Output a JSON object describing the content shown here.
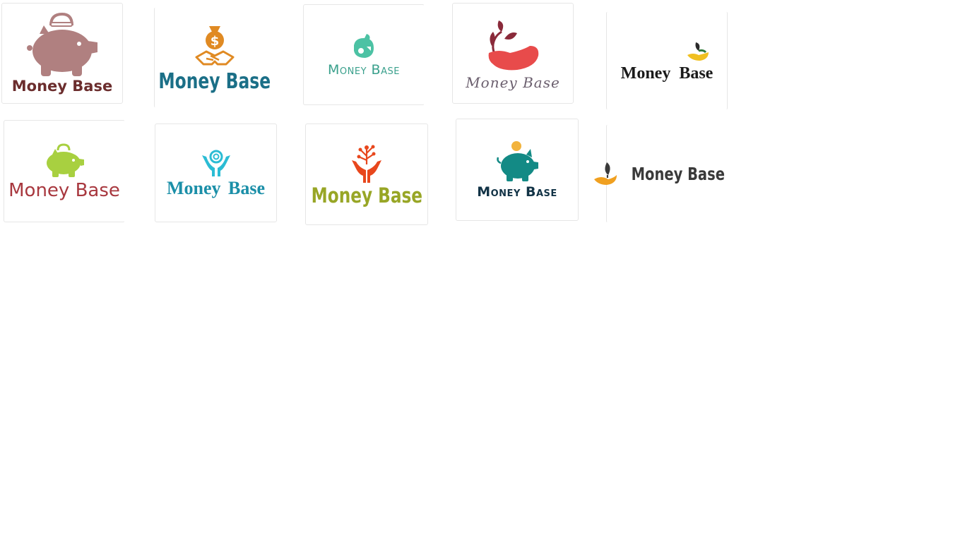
{
  "logos": [
    {
      "brand": "Money Base",
      "icon": "piggy-bank-icon",
      "color": "#b08080"
    },
    {
      "brand": "Money Base",
      "icon": "money-bag-handshake-icon",
      "color": "#e08a23"
    },
    {
      "brand": "Money Base",
      "icon": "hand-coin-icon",
      "color": "#4cc2a4"
    },
    {
      "brand": "Money Base",
      "icon": "hand-leaf-icon",
      "color": "#e84b4b"
    },
    {
      "brand": "Money Base",
      "icon": "hand-sprout-icon",
      "color": "#f0c020"
    },
    {
      "brand": "Money Base",
      "icon": "piggy-bank-icon",
      "color": "#a8d040"
    },
    {
      "brand": "Money Base",
      "icon": "hands-spiral-icon",
      "color": "#2bbcd4"
    },
    {
      "brand": "Money Base",
      "icon": "hands-tree-icon",
      "color": "#e8471d"
    },
    {
      "brand": "Money Base",
      "icon": "piggy-bank-coin-icon",
      "color": "#138a85"
    },
    {
      "brand": "Money Base",
      "icon": "hand-leaf-icon",
      "color": "#f0a020"
    }
  ]
}
